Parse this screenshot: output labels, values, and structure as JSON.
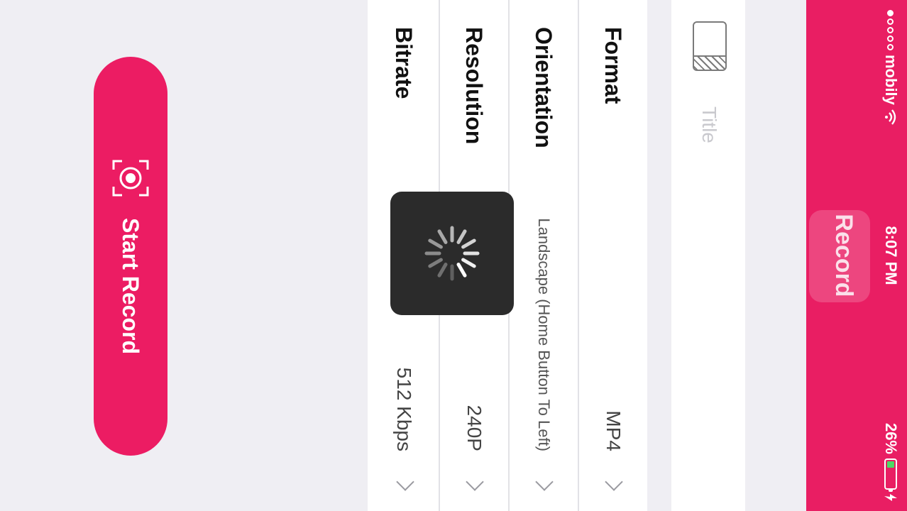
{
  "status_bar": {
    "carrier": "mobily",
    "time": "8:07 PM",
    "battery": "26%",
    "battery_level": 0.26
  },
  "nav": {
    "title": "Record"
  },
  "title_field": {
    "placeholder": "Title",
    "value": ""
  },
  "settings": {
    "rows": [
      {
        "label": "Format",
        "value": "MP4"
      },
      {
        "label": "Orientation",
        "value": "Landscape (Home Button To Left)"
      },
      {
        "label": "Resolution",
        "value": "240P"
      },
      {
        "label": "Bitrate",
        "value": "512 Kbps"
      }
    ]
  },
  "start_button": {
    "label": "Start Record"
  },
  "colors": {
    "accent": "#e91e63",
    "background": "#efeef3"
  },
  "icons": {
    "title": "clapperboard-icon",
    "chevron": "chevron-right-icon",
    "spinner": "loading-spinner-icon",
    "record": "record-target-icon"
  }
}
